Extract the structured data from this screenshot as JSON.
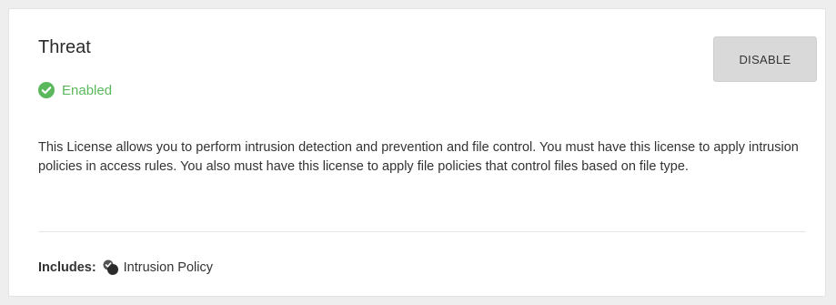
{
  "license": {
    "title": "Threat",
    "status_text": "Enabled",
    "status_icon": "check-circle-icon",
    "status_color": "#5cb85c",
    "action_label": "DISABLE",
    "description": "This License allows you to perform intrusion detection and prevention and file control. You must have this license to apply intrusion policies in access rules. You also must have this license to apply file policies that control files based on file type.",
    "includes_label": "Includes:",
    "includes_items": [
      {
        "icon": "intrusion-policy-icon",
        "label": "Intrusion Policy"
      }
    ]
  }
}
